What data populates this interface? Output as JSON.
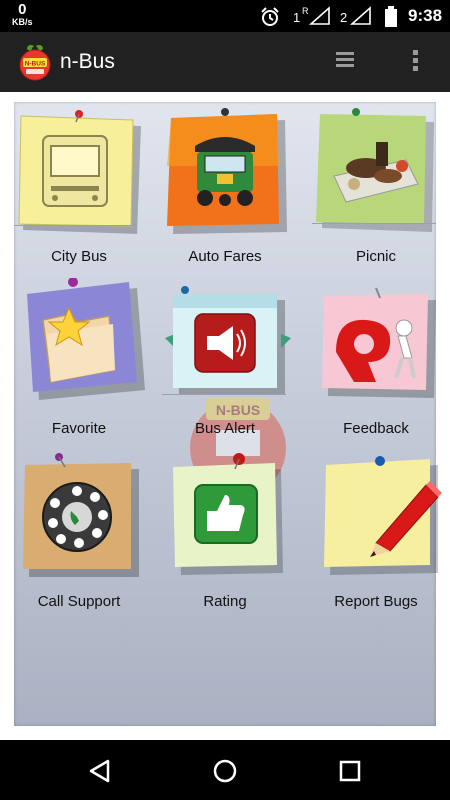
{
  "status_bar": {
    "speed_value": "0",
    "speed_unit": "KB/s",
    "sim1_badge": "1",
    "sim1_roaming": "R",
    "sim2_badge": "2",
    "time": "9:38",
    "icons": [
      "alarm-icon",
      "signal-icon",
      "signal-icon",
      "battery-icon"
    ]
  },
  "app_bar": {
    "title": "n-Bus",
    "logo_text": "N-BUS",
    "menu_icon": "hamburger-icon",
    "overflow_icon": "more-vertical-icon"
  },
  "watermark_text": "N-BUS",
  "tiles": [
    {
      "label": "City Bus",
      "icon": "bus-front-icon"
    },
    {
      "label": "Auto Fares",
      "icon": "auto-rickshaw-icon"
    },
    {
      "label": "Picnic",
      "icon": "picnic-food-icon"
    },
    {
      "label": "Favorite",
      "icon": "folder-star-icon"
    },
    {
      "label": "Bus Alert",
      "icon": "megaphone-icon"
    },
    {
      "label": "Feedback",
      "icon": "feedback-person-icon"
    },
    {
      "label": "Call Support",
      "icon": "rotary-phone-icon"
    },
    {
      "label": "Rating",
      "icon": "thumbs-up-icon"
    },
    {
      "label": "Report Bugs",
      "icon": "pencil-icon"
    }
  ],
  "nav_bar": {
    "back_icon": "back-icon",
    "home_icon": "home-icon",
    "recent_icon": "recent-apps-icon"
  },
  "colors": {
    "status_bar": "#000000",
    "app_bar": "#212121",
    "panel_top": "#e1e5ee",
    "panel_bottom": "#aab1c2",
    "note_yellow": "#f7ef9a",
    "note_orange": "#f2721c",
    "note_green": "#b8d77a",
    "note_purple": "#8b86d6",
    "note_cyan": "#d8f2f6",
    "note_pink": "#f8c7d4",
    "note_tan": "#d9ac70",
    "note_lightgreen": "#e8f4c8",
    "note_paleyellow": "#f6ef9f"
  }
}
